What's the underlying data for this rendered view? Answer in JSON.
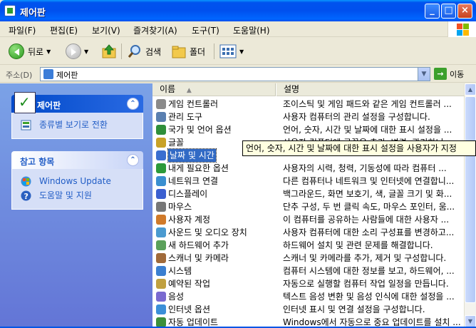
{
  "window": {
    "title": "제어판"
  },
  "menu": [
    "파일(F)",
    "편집(E)",
    "보기(V)",
    "즐겨찾기(A)",
    "도구(T)",
    "도움말(H)"
  ],
  "toolbar": {
    "back": "뒤로",
    "search": "검색",
    "folders": "폴더"
  },
  "address": {
    "label": "주소(D)",
    "value": "제어판",
    "go": "이동"
  },
  "left": {
    "panel1": {
      "title": "제어판",
      "link": "종류별 보기로 전환"
    },
    "panel2": {
      "title": "참고 항목",
      "links": [
        "Windows Update",
        "도움말 및 지원"
      ]
    }
  },
  "list": {
    "columns": [
      "이름",
      "설명"
    ],
    "rows": [
      {
        "name": "게임 컨트롤러",
        "desc": "조이스틱 및 게임 패드와 같은 게임 컨트롤러 ..."
      },
      {
        "name": "관리 도구",
        "desc": "사용자 컴퓨터의 관리 설정을 구성합니다."
      },
      {
        "name": "국가 및 언어 옵션",
        "desc": "언어, 숫자, 시간 및 날짜에 대한 표시 설정을 ..."
      },
      {
        "name": "글꼴",
        "desc": "사용자 컴퓨터에 글꼴을 추가, 변경, 관리하니..."
      },
      {
        "name": "날짜 및 시간",
        "desc": ""
      },
      {
        "name": "내게 필요한 옵션",
        "desc": "사용자의 시력, 청력, 기동성에 따라 컴퓨터 ..."
      },
      {
        "name": "네트워크 연결",
        "desc": "다른 컴퓨터나 네트워크 및 인터넷에 연결합니..."
      },
      {
        "name": "디스플레이",
        "desc": "백그라운드, 화면 보호기, 색, 글꼴 크기 및 화..."
      },
      {
        "name": "마우스",
        "desc": "단추 구성, 두 번 클릭 속도, 마우스 포인터, 움..."
      },
      {
        "name": "사용자 계정",
        "desc": "이 컴퓨터를 공유하는 사람들에 대한 사용자 ..."
      },
      {
        "name": "사운드 및 오디오 장치",
        "desc": "사용자 컴퓨터에 대한 소리 구성표를 변경하고..."
      },
      {
        "name": "새 하드웨어 추가",
        "desc": "하드웨어 설치 및 관련 문제를 해결합니다."
      },
      {
        "name": "스캐너 및 카메라",
        "desc": "스캐너 및 카메라를 추가, 제거 및 구성합니다."
      },
      {
        "name": "시스템",
        "desc": "컴퓨터 시스템에 대한 정보를 보고, 하드웨어, ..."
      },
      {
        "name": "예약된 작업",
        "desc": "자동으로 실행할 컴퓨터 작업 일정을 만듭니다."
      },
      {
        "name": "음성",
        "desc": "텍스트 음성 변환 및 음성 인식에 대한 설정을 ..."
      },
      {
        "name": "인터넷 옵션",
        "desc": "인터넷 표시 및 연결 설정을 구성합니다."
      },
      {
        "name": "자동 업데이트",
        "desc": "Windows에서 자동으로 중요 업데이트를 설치 ..."
      }
    ],
    "selected_index": 4
  },
  "tooltip": "언어, 숫자, 시간 및 날짜에 대한 표시 설정을 사용자가 지정",
  "icon_colors": [
    "#8a8a8a",
    "#5a7fb0",
    "#2f8f3a",
    "#c9a227",
    "#3b6fd0",
    "#2c9a3a",
    "#3a8fd0",
    "#3b5fd0",
    "#777777",
    "#d07a2a",
    "#4a9ad0",
    "#5aa05a",
    "#a06a3a",
    "#3b7fd0",
    "#c0a040",
    "#7a6ad0",
    "#3b8fd8",
    "#3c8f3c"
  ]
}
